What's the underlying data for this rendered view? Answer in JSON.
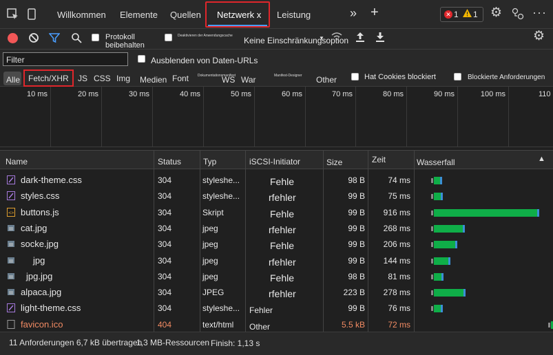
{
  "tabs": {
    "welcome": "Willkommen",
    "elements": "Elemente",
    "sources": "Quellen",
    "network": "Netzwerk x",
    "performance": "Leistung",
    "more": "»",
    "add": "+"
  },
  "badges": {
    "errors": "1",
    "warnings": "1"
  },
  "toolbar1": {
    "preserve_log": "Protokoll beibehalten",
    "disable_cache": "Deaktivieren der Anwendungscache",
    "throttling": "Keine Einschränkungsoption"
  },
  "toolbar2": {
    "filter_placeholder": "Filter",
    "hide_data_urls": "Ausblenden von Daten-URLs"
  },
  "type_filters": {
    "all": "Alle",
    "fetch": "Fetch/XHR",
    "js": "JS",
    "css": "CSS",
    "img": "Img",
    "media": "Medien",
    "font": "Font",
    "doc": "Dokumentationsmanifest",
    "ws": "WS",
    "wasm": "War",
    "manifest": "Manifest-Designer",
    "other": "Other",
    "blocked_cookies": "Hat Cookies blockiert",
    "blocked_requests": "Blockierte Anforderungen"
  },
  "timeline": {
    "ticks": [
      "10 ms",
      "20 ms",
      "30 ms",
      "40 ms",
      "50 ms",
      "60 ms",
      "70 ms",
      "80 ms",
      "90 ms",
      "100 ms",
      "110"
    ]
  },
  "columns": {
    "name": "Name",
    "status": "Status",
    "type": "Typ",
    "initiator": "iSCSI-Initiator",
    "size": "Size",
    "time": "Zeit",
    "waterfall": "Wasserfall"
  },
  "rows": [
    {
      "name": "dark-theme.css",
      "status": "304",
      "type": "styleshe...",
      "initiator": "Fehle",
      "size": "98 B",
      "time": "74 ms",
      "icon": "css-file-icon",
      "bar_start_ms": 0,
      "bar_duration_ms": 74
    },
    {
      "name": "styles.css",
      "status": "304",
      "type": "styleshe...",
      "initiator": "rfehler",
      "size": "99 B",
      "time": "75 ms",
      "icon": "css-file-icon",
      "bar_start_ms": 0,
      "bar_duration_ms": 75
    },
    {
      "name": "buttons.js",
      "status": "304",
      "type": "Skript",
      "initiator": "Fehle",
      "size": "99 B",
      "time": "916 ms",
      "icon": "js-file-icon",
      "bar_start_ms": 0,
      "bar_duration_ms": 916
    },
    {
      "name": "cat.jpg",
      "status": "304",
      "type": "jpeg",
      "initiator": "rfehler",
      "size": "99 B",
      "time": "268 ms",
      "icon": "image-file-icon",
      "bar_start_ms": 0,
      "bar_duration_ms": 268
    },
    {
      "name": "socke.jpg",
      "status": "304",
      "type": "jpeg",
      "initiator": "Fehle",
      "size": "99 B",
      "time": "206 ms",
      "icon": "image-file-icon",
      "bar_start_ms": 0,
      "bar_duration_ms": 206
    },
    {
      "name": "jpg",
      "status": "304",
      "type": "jpeg",
      "initiator": "rfehler",
      "size": "99 B",
      "time": "144 ms",
      "icon": "image-file-icon",
      "bar_start_ms": 0,
      "bar_duration_ms": 144
    },
    {
      "name": "jpg.jpg",
      "status": "304",
      "type": "jpeg",
      "initiator": "Fehle",
      "size": "98 B",
      "time": "81 ms",
      "icon": "image-file-icon",
      "bar_start_ms": 0,
      "bar_duration_ms": 81
    },
    {
      "name": "alpaca.jpg",
      "status": "304",
      "type": "JPEG",
      "initiator": "rfehler",
      "size": "223 B",
      "time": "278 ms",
      "icon": "image-file-icon",
      "bar_start_ms": 0,
      "bar_duration_ms": 278
    },
    {
      "name": "light-theme.css",
      "status": "304",
      "type": "styleshe...",
      "initiator": "Fehler",
      "size": "99 B",
      "time": "76 ms",
      "icon": "css-file-icon",
      "bar_start_ms": 0,
      "bar_duration_ms": 76
    },
    {
      "name": "favicon.ico",
      "status": "404",
      "type": "text/html",
      "initiator": "Other",
      "size": "5.5 kB",
      "time": "72 ms",
      "icon": "document-file-icon",
      "bar_start_ms": 1015,
      "bar_duration_ms": 72,
      "error": true
    }
  ],
  "status_bar": {
    "requests": "11 Anforderungen 6,7 kB übertragen",
    "resources": "1,3 MB-Ressourcen",
    "finish": "Finish: 1,13 s"
  },
  "colors": {
    "accent": "#4a9eff",
    "highlight": "#e0262b",
    "bar": "#0fae48",
    "error_text": "#f28b63",
    "record": "#f25757"
  }
}
